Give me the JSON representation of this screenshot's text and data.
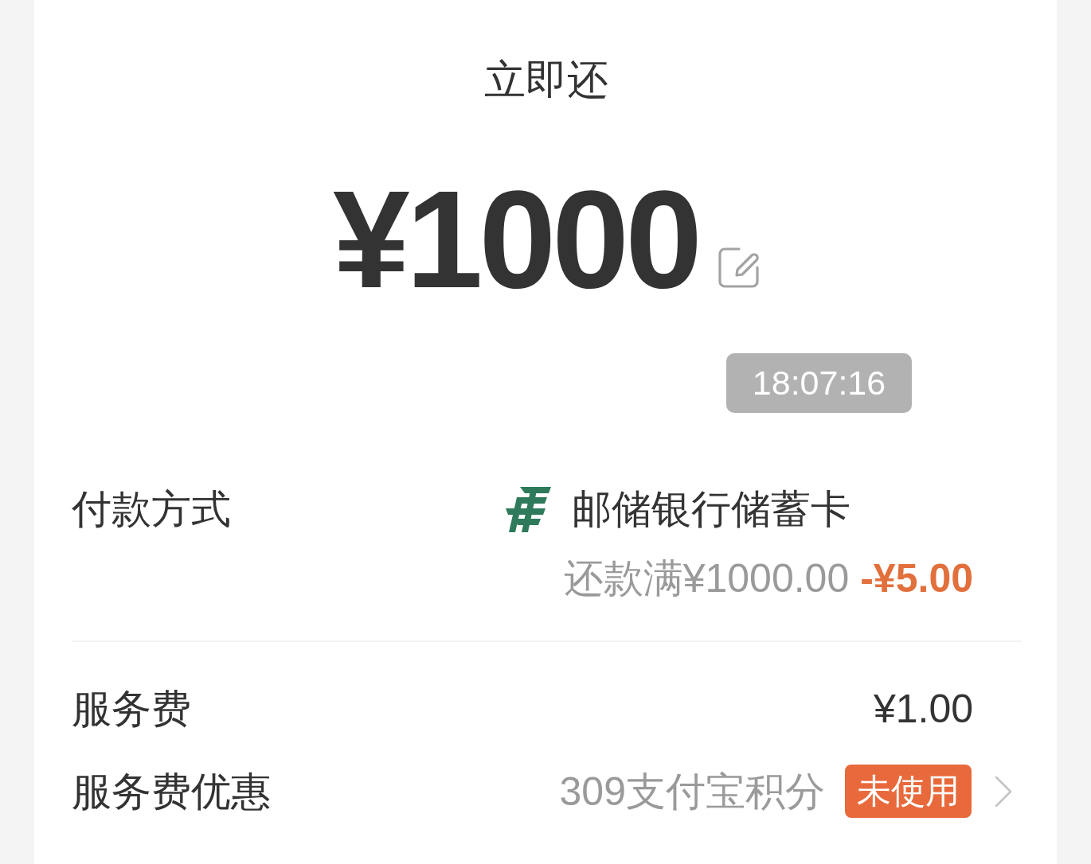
{
  "header": {
    "title": "立即还"
  },
  "amount": {
    "value": "¥1000"
  },
  "timer": "18:07:16",
  "payment": {
    "label": "付款方式",
    "method": "邮储银行储蓄卡",
    "promo": {
      "condition": "还款满¥1000.00",
      "discount": "-¥5.00"
    }
  },
  "fees": [
    {
      "kind": "amount",
      "label": "服务费",
      "value": "¥1.00"
    },
    {
      "kind": "points",
      "label": "服务费优惠",
      "value": "309支付宝积分",
      "badge": "未使用"
    }
  ]
}
